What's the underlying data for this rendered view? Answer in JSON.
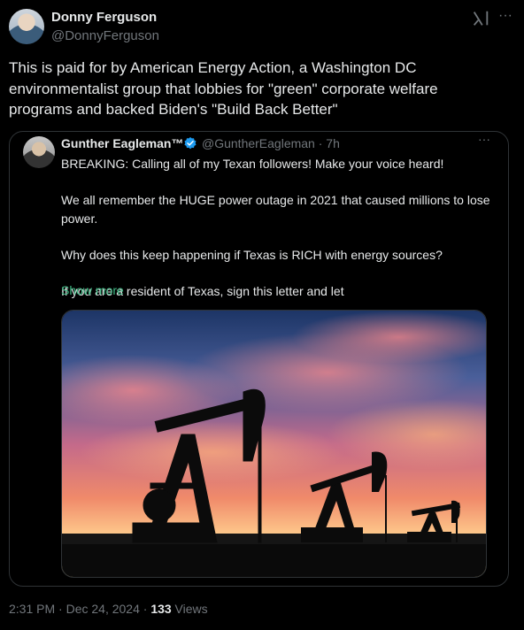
{
  "tweet": {
    "author_name": "Donny Ferguson",
    "author_handle": "@DonnyFerguson",
    "text": "This is paid for by American Energy Action, a Washington DC environmentalist group that lobbies for \"green\" corporate welfare programs and backed Biden's \"Build Back Better\"",
    "more_label": "···",
    "icons": {
      "grok": "grok-icon",
      "more": "more-icon"
    }
  },
  "quote": {
    "author_name": "Gunther Eagleman™",
    "author_handle": "@GuntherEagleman · 7h",
    "more_label": "···",
    "paragraphs": [
      "BREAKING: Calling all of my Texan followers! Make your voice heard!",
      "We all remember the HUGE power outage in 2021 that caused millions to lose power.",
      "Why does this keep happening if Texas is RICH with energy sources?",
      "If you are a resident of Texas, sign this letter and let"
    ],
    "show_more": "Show more",
    "icons": {
      "verified": "verified-badge-icon"
    }
  },
  "footer": {
    "timestamp": "2:31 PM · Dec 24, 2024 · ",
    "views_count": "133",
    "views_label": " Views"
  },
  "colors": {
    "background": "#000000",
    "text": "#e7e9ea",
    "muted": "#71767b",
    "border": "#2f3336",
    "show_more": "#3fb984",
    "verified": "#1d9bf0"
  }
}
